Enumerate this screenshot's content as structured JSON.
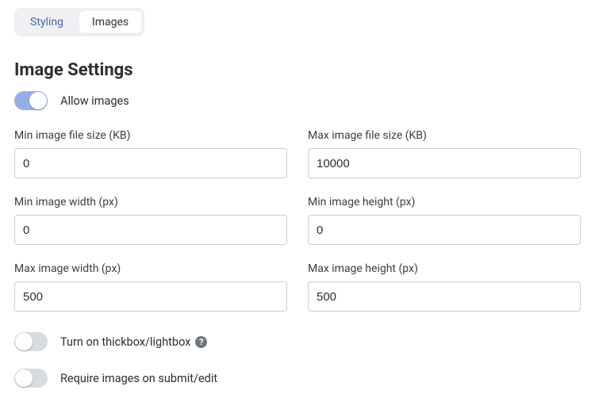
{
  "tabs": {
    "styling": "Styling",
    "images": "Images"
  },
  "heading": "Image Settings",
  "toggles": {
    "allow_images": {
      "label": "Allow images",
      "on": true
    },
    "lightbox": {
      "label": "Turn on thickbox/lightbox",
      "on": false
    },
    "require": {
      "label": "Require images on submit/edit",
      "on": false
    }
  },
  "fields": {
    "min_size": {
      "label": "Min image file size (KB)",
      "value": "0"
    },
    "max_size": {
      "label": "Max image file size (KB)",
      "value": "10000"
    },
    "min_width": {
      "label": "Min image width (px)",
      "value": "0"
    },
    "min_height": {
      "label": "Min image height (px)",
      "value": "0"
    },
    "max_width": {
      "label": "Max image width (px)",
      "value": "500"
    },
    "max_height": {
      "label": "Max image height (px)",
      "value": "500"
    }
  },
  "help_glyph": "?"
}
